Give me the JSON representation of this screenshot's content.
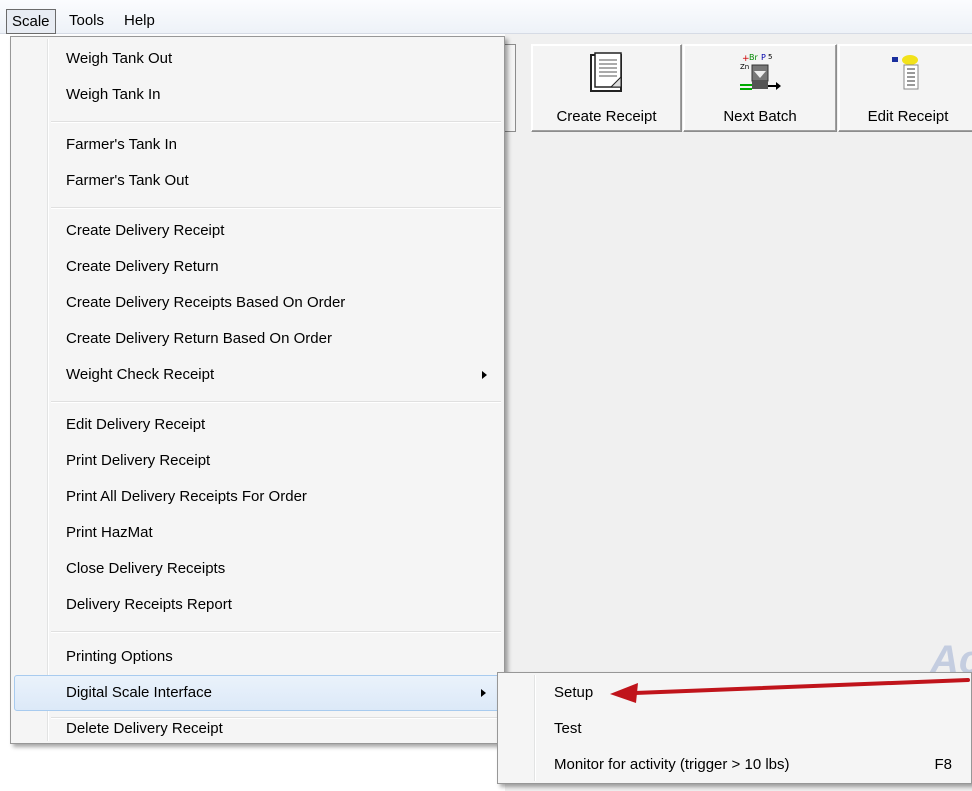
{
  "menubar": {
    "items": [
      {
        "label": "Scale"
      },
      {
        "label": "Tools"
      },
      {
        "label": "Help"
      }
    ]
  },
  "toolbar": {
    "buttons": [
      {
        "label": "Create Receipt",
        "icon": "document-icon"
      },
      {
        "label": "Next Batch",
        "icon": "batch-icon"
      },
      {
        "label": "Edit Receipt",
        "icon": "edit-receipt-icon"
      }
    ]
  },
  "watermark": "Ac",
  "scale_menu": {
    "items": [
      {
        "label": "Weigh Tank Out"
      },
      {
        "label": "Weigh Tank In"
      },
      {
        "label": "Farmer's Tank In"
      },
      {
        "label": "Farmer's Tank Out"
      },
      {
        "label": "Create Delivery Receipt"
      },
      {
        "label": "Create Delivery Return"
      },
      {
        "label": "Create Delivery Receipts Based On Order"
      },
      {
        "label": "Create Delivery Return Based On Order"
      },
      {
        "label": "Weight Check Receipt"
      },
      {
        "label": "Edit Delivery Receipt"
      },
      {
        "label": "Print Delivery Receipt"
      },
      {
        "label": "Print All Delivery Receipts For Order"
      },
      {
        "label": "Print HazMat"
      },
      {
        "label": "Close Delivery Receipts"
      },
      {
        "label": "Delivery Receipts Report"
      },
      {
        "label": "Printing Options"
      },
      {
        "label": "Digital Scale Interface"
      },
      {
        "label": "Delete Delivery Receipt"
      }
    ]
  },
  "digital_scale_submenu": {
    "items": [
      {
        "label": "Setup",
        "shortcut": ""
      },
      {
        "label": "Test",
        "shortcut": ""
      },
      {
        "label": "Monitor for activity (trigger > 10 lbs)",
        "shortcut": "F8"
      }
    ]
  },
  "colors": {
    "highlight_border": "#a8cbef",
    "highlight_fill": "#dce9f8",
    "annotation_arrow": "#c0141b"
  }
}
